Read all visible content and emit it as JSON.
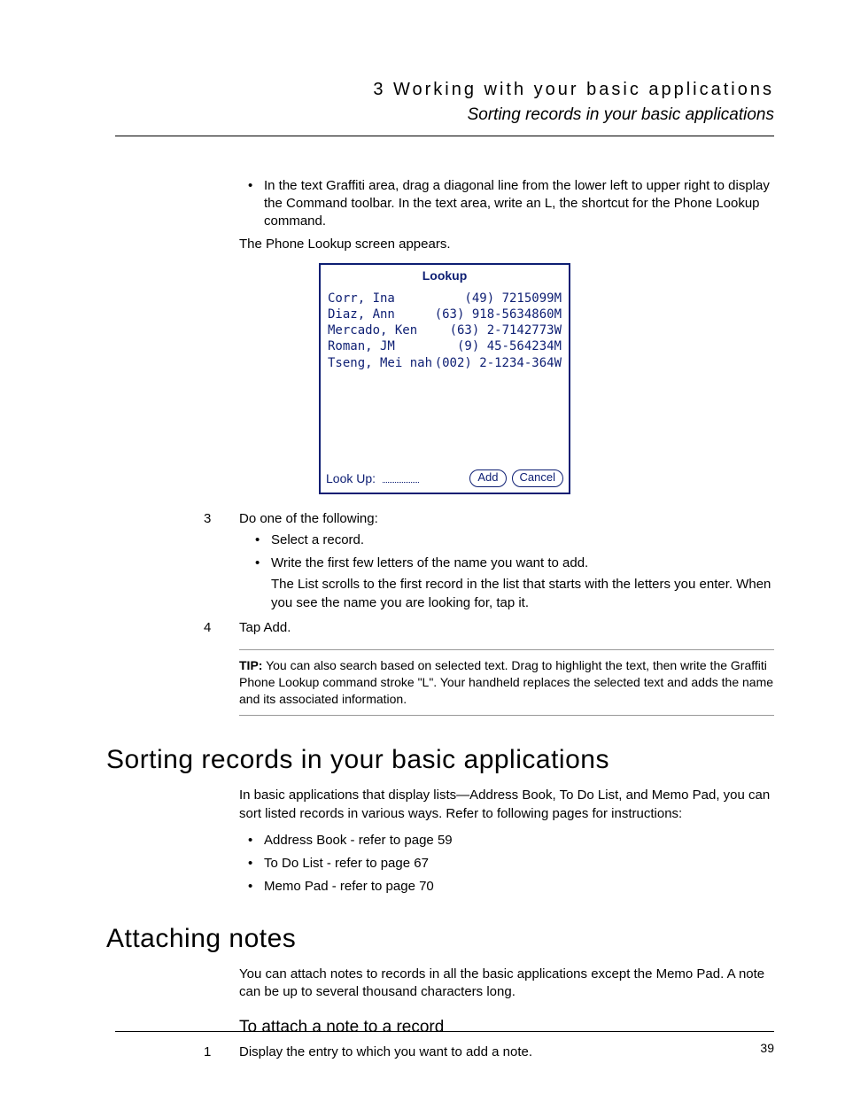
{
  "header": {
    "chapter": "3 Working with your basic applications",
    "section": "Sorting records in your basic applications"
  },
  "intro_bullet": "In the text Graffiti area, drag a diagonal line from the lower left to upper right to display the Command toolbar. In the text area, write an L, the shortcut for the Phone Lookup command.",
  "intro_after": "The Phone Lookup screen appears.",
  "lookup": {
    "title": "Lookup",
    "rows": [
      {
        "name": "Corr, Ina",
        "phone": "(49) 7215099M"
      },
      {
        "name": "Diaz, Ann",
        "phone": "(63) 918-5634860M"
      },
      {
        "name": "Mercado, Ken",
        "phone": "(63) 2-7142773W"
      },
      {
        "name": "Roman, JM",
        "phone": "(9) 45-564234M"
      },
      {
        "name": "Tseng, Mei nah",
        "phone": "(002) 2-1234-364W"
      }
    ],
    "footer": {
      "label": "Look Up:",
      "add": "Add",
      "cancel": "Cancel"
    }
  },
  "steps": {
    "s3": {
      "num": "3",
      "text": "Do one of the following:",
      "bullets": [
        {
          "lead": "Select a record."
        },
        {
          "lead": "Write the first few letters of the name you want to add.",
          "follow": "The List scrolls to the first record in the list that starts with the letters you enter. When you see the name you are looking for, tap it."
        }
      ]
    },
    "s4": {
      "num": "4",
      "text": "Tap Add."
    }
  },
  "tip": {
    "label": "TIP:",
    "text": "You can also search based on selected text. Drag to highlight the text, then write the Graffiti Phone Lookup command stroke \"L\". Your handheld replaces the selected text and adds the name and its associated information."
  },
  "sorting": {
    "heading": "Sorting records in your basic applications",
    "para": "In basic applications that display lists—Address Book, To Do List, and Memo Pad, you can sort listed records in various ways. Refer to following pages for instructions:",
    "bullets": [
      "Address Book - refer to page 59",
      "To Do List - refer to page 67",
      "Memo Pad - refer to page 70"
    ]
  },
  "notes": {
    "heading": "Attaching notes",
    "para": "You can attach notes to records in all the basic applications except the Memo Pad. A note can be up to several thousand characters long.",
    "subhead": "To attach a note to a record",
    "step1_num": "1",
    "step1_text": "Display the entry to which you want to add a note."
  },
  "page_number": "39"
}
